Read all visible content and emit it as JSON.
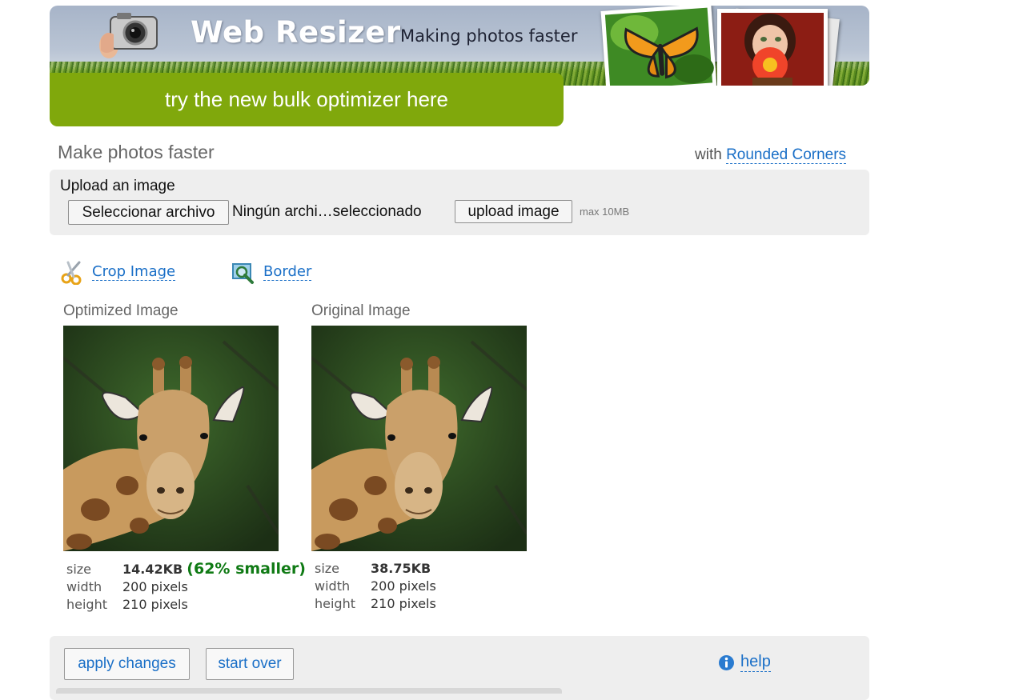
{
  "banner": {
    "logo": "Web Resizer",
    "tagline": "Making photos faster",
    "bulk_label": "try the new bulk optimizer here"
  },
  "heading": {
    "title": "Make photos faster",
    "with_text": "with",
    "corners_link": "Rounded Corners"
  },
  "upload": {
    "label": "Upload an image",
    "file_button": "Seleccionar archivo",
    "file_status": "Ningún archi…seleccionado",
    "upload_button": "upload image",
    "max_note": "max 10MB"
  },
  "tools": {
    "crop_label": "Crop Image",
    "border_label": "Border"
  },
  "optimized": {
    "title": "Optimized Image",
    "size_key": "size",
    "size_value": "14.42KB",
    "smaller": "(62% smaller)",
    "width_key": "width",
    "width_value": "200 pixels",
    "height_key": "height",
    "height_value": "210 pixels"
  },
  "original": {
    "title": "Original Image",
    "size_key": "size",
    "size_value": "38.75KB",
    "width_key": "width",
    "width_value": "200 pixels",
    "height_key": "height",
    "height_value": "210 pixels"
  },
  "actions": {
    "apply_label": "apply changes",
    "start_over_label": "start over",
    "help_label": "help"
  },
  "colors": {
    "accent_green": "#80a80c",
    "link_blue": "#1a6fc7",
    "success_green": "#0f7a14"
  }
}
